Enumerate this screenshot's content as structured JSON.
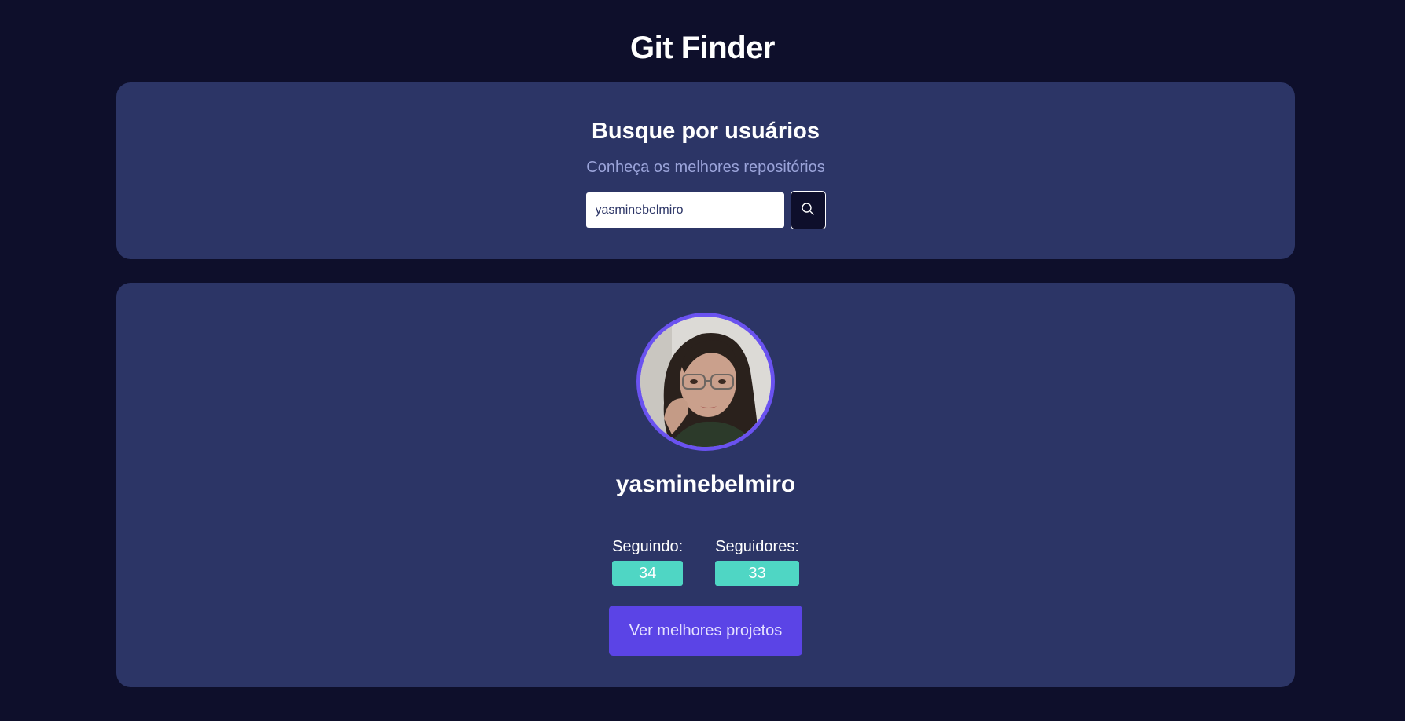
{
  "app": {
    "title": "Git Finder"
  },
  "search": {
    "heading": "Busque por usuários",
    "subtitle": "Conheça os melhores repositórios",
    "input_value": "yasminebelmiro",
    "button_icon": "search-icon"
  },
  "profile": {
    "avatar_icon": "user-avatar",
    "username": "yasminebelmiro",
    "following_label": "Seguindo:",
    "following_value": "34",
    "followers_label": "Seguidores:",
    "followers_value": "33",
    "best_projects_label": "Ver melhores projetos"
  },
  "colors": {
    "background": "#0e0f2b",
    "panel": "#2c3566",
    "accent": "#5b44e6",
    "avatar_ring": "#6a52f0",
    "stat_badge": "#4fd6c4",
    "subtitle": "#9aa3d9"
  }
}
